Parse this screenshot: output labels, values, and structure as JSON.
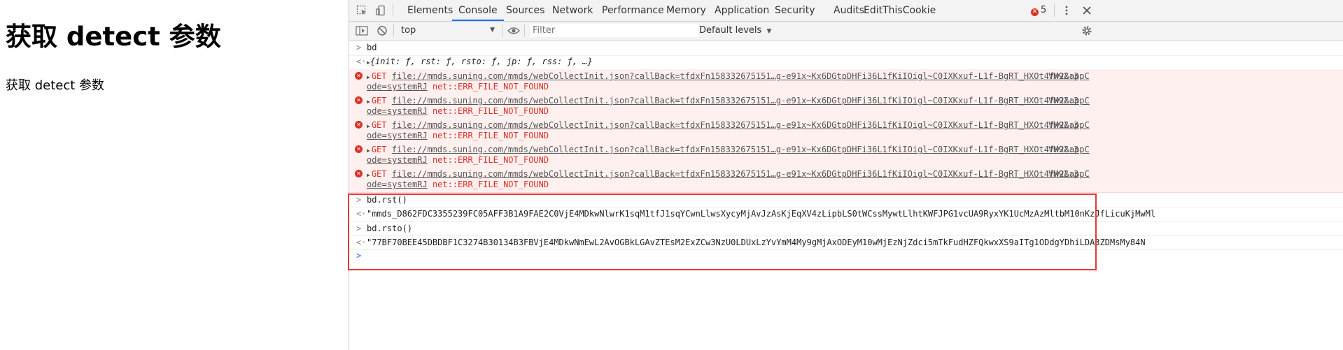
{
  "page": {
    "heading": "获取 detect 参数",
    "paragraph": "获取 detect 参数"
  },
  "devtools": {
    "tabs": [
      "Elements",
      "Console",
      "Sources",
      "Network",
      "Performance",
      "Memory",
      "Application",
      "Security",
      "Audits",
      "EditThisCookie"
    ],
    "active_tab": "Console",
    "error_count": "5",
    "context": "top",
    "filter_placeholder": "Filter",
    "levels_label": "Default levels",
    "accent": "#1a73e8",
    "error_color": "#d93025"
  },
  "console": {
    "cmd1": "bd",
    "result1": "{init: ƒ, rst: ƒ, rsto: ƒ, jp: ƒ, rss: ƒ, …}",
    "errors": [
      {
        "method": "GET",
        "url": "file://mmds.suning.com/mmds/webCollectInit.json?callBack=tfdxFn158332675151…g-e91x~Kx6DGtpDHFi36L1fKiIOigl~C0IXKxuf-L1f-BgRT_HXOt4fw2&appC",
        "url2": "ode=systemRJ",
        "message": "net::ERR_FILE_NOT_FOUND",
        "source": "VM92:3"
      },
      {
        "method": "GET",
        "url": "file://mmds.suning.com/mmds/webCollectInit.json?callBack=tfdxFn158332675151…g-e91x~Kx6DGtpDHFi36L1fKiIOigl~C0IXKxuf-L1f-BgRT_HXOt4fw2&appC",
        "url2": "ode=systemRJ",
        "message": "net::ERR_FILE_NOT_FOUND",
        "source": "VM92:3"
      },
      {
        "method": "GET",
        "url": "file://mmds.suning.com/mmds/webCollectInit.json?callBack=tfdxFn158332675151…g-e91x~Kx6DGtpDHFi36L1fKiIOigl~C0IXKxuf-L1f-BgRT_HXOt4fw2&appC",
        "url2": "ode=systemRJ",
        "message": "net::ERR_FILE_NOT_FOUND",
        "source": "VM92:3"
      },
      {
        "method": "GET",
        "url": "file://mmds.suning.com/mmds/webCollectInit.json?callBack=tfdxFn158332675151…g-e91x~Kx6DGtpDHFi36L1fKiIOigl~C0IXKxuf-L1f-BgRT_HXOt4fw2&appC",
        "url2": "ode=systemRJ",
        "message": "net::ERR_FILE_NOT_FOUND",
        "source": "VM92:3"
      },
      {
        "method": "GET",
        "url": "file://mmds.suning.com/mmds/webCollectInit.json?callBack=tfdxFn158332675151…g-e91x~Kx6DGtpDHFi36L1fKiIOigl~C0IXKxuf-L1f-BgRT_HXOt4fw2&appC",
        "url2": "ode=systemRJ",
        "message": "net::ERR_FILE_NOT_FOUND",
        "source": "VM92:3"
      }
    ],
    "cmd2": "bd.rst()",
    "result2": "\"mmds_D862FDC3355239FC05AFF3B1A9FAE2C0VjE4MDkwNlwrK1sqM1tfJ1sqYCwnLlwsXycyMjAvJzAsKjEqXV4zLipbLS0tWCssMywtLlhtKWFJPG1vcUA9RyxYK1UcMzAzMltbM10nKzJfLicuKjMwMl",
    "cmd3": "bd.rsto()",
    "result3": "\"77BF70BEE45DBDBF1C3274B30134B3FBVjE4MDkwNmEwL2AvOGBkLGAvZTEsM2ExZCw3NzU0LDUxLzYvYmM4My9gMjAxODEyM10wMjEzNjZdci5mTkFudHZFQkwxXS9aITg1ODdgYDhiLDA3ZDMsMy84N"
  }
}
